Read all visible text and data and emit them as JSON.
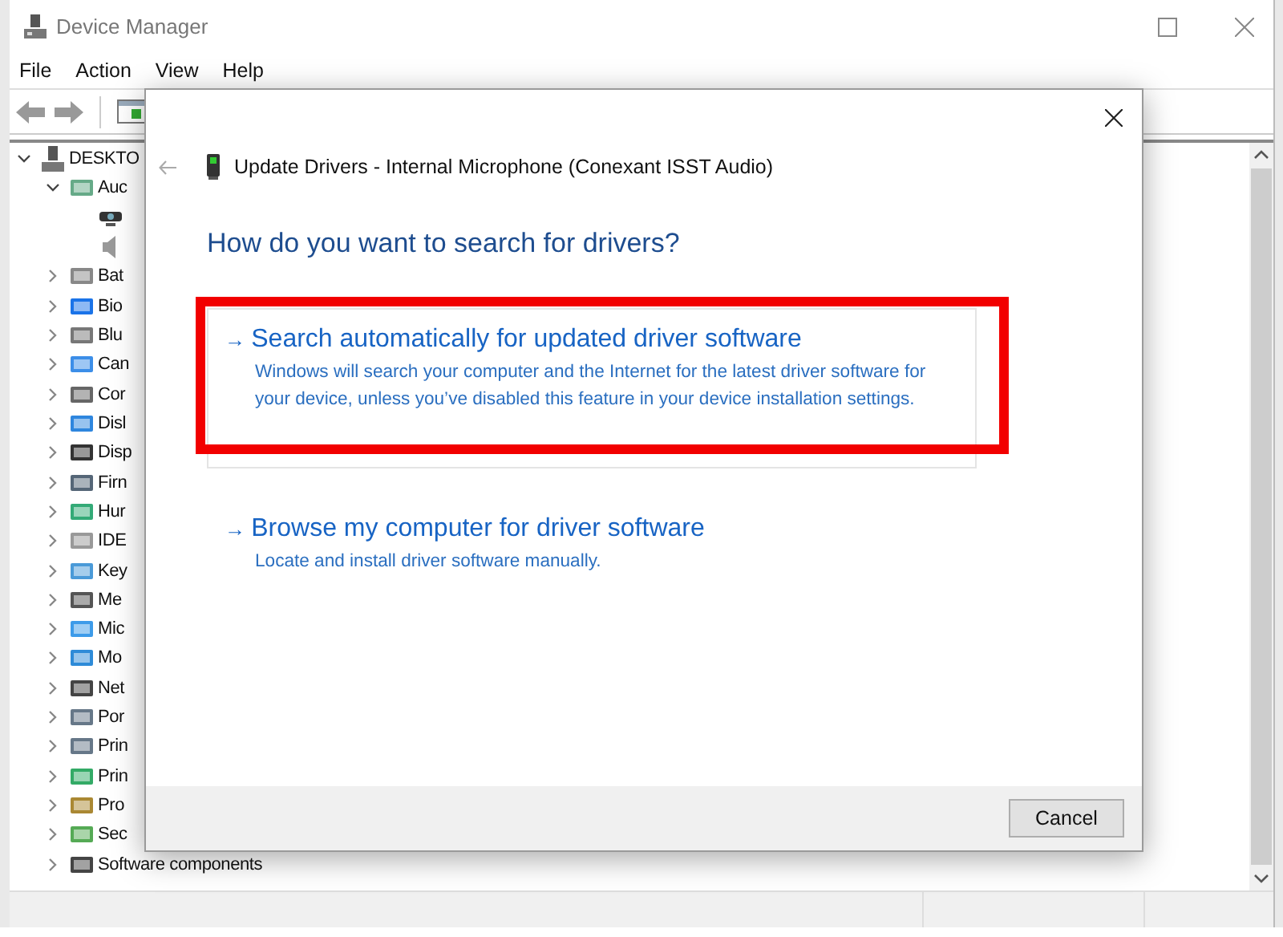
{
  "window": {
    "title": "Device Manager"
  },
  "menu": [
    "File",
    "Action",
    "View",
    "Help"
  ],
  "tree": [
    {
      "kind": "computer",
      "label": "DESKTO",
      "expanded": true,
      "children": [
        {
          "kind": "category",
          "label": "Auc",
          "expanded": true,
          "children": [
            {
              "kind": "device"
            },
            {
              "kind": "device"
            }
          ]
        },
        {
          "kind": "category",
          "label": "Bat",
          "expanded": false
        },
        {
          "kind": "category",
          "label": "Bio",
          "expanded": false
        },
        {
          "kind": "category",
          "label": "Blu",
          "expanded": false
        },
        {
          "kind": "category",
          "label": "Can",
          "expanded": false
        },
        {
          "kind": "category",
          "label": "Cor",
          "expanded": false
        },
        {
          "kind": "category",
          "label": "Disl",
          "expanded": false
        },
        {
          "kind": "category",
          "label": "Disp",
          "expanded": false
        },
        {
          "kind": "category",
          "label": "Firn",
          "expanded": false
        },
        {
          "kind": "category",
          "label": "Hur",
          "expanded": false
        },
        {
          "kind": "category",
          "label": "IDE",
          "expanded": false
        },
        {
          "kind": "category",
          "label": "Key",
          "expanded": false
        },
        {
          "kind": "category",
          "label": "Me",
          "expanded": false
        },
        {
          "kind": "category",
          "label": "Mic",
          "expanded": false
        },
        {
          "kind": "category",
          "label": "Mo",
          "expanded": false
        },
        {
          "kind": "category",
          "label": "Net",
          "expanded": false
        },
        {
          "kind": "category",
          "label": "Por",
          "expanded": false
        },
        {
          "kind": "category",
          "label": "Prin",
          "expanded": false
        },
        {
          "kind": "category",
          "label": "Prin",
          "expanded": false
        },
        {
          "kind": "category",
          "label": "Pro",
          "expanded": false
        },
        {
          "kind": "category",
          "label": "Sec",
          "expanded": false
        },
        {
          "kind": "category",
          "label": "Software components",
          "expanded": false
        }
      ]
    }
  ],
  "dialog": {
    "title": "Update Drivers - Internal Microphone (Conexant ISST Audio)",
    "heading": "How do you want to search for drivers?",
    "options": [
      {
        "arrow": "→",
        "title": "Search automatically for updated driver software",
        "description": "Windows will search your computer and the Internet for the latest driver software for your device, unless you’ve disabled this feature in your device installation settings.",
        "highlighted": true
      },
      {
        "arrow": "→",
        "title": "Browse my computer for driver software",
        "description": "Locate and install driver software manually.",
        "highlighted": false
      }
    ],
    "buttons": [
      "Cancel"
    ]
  }
}
